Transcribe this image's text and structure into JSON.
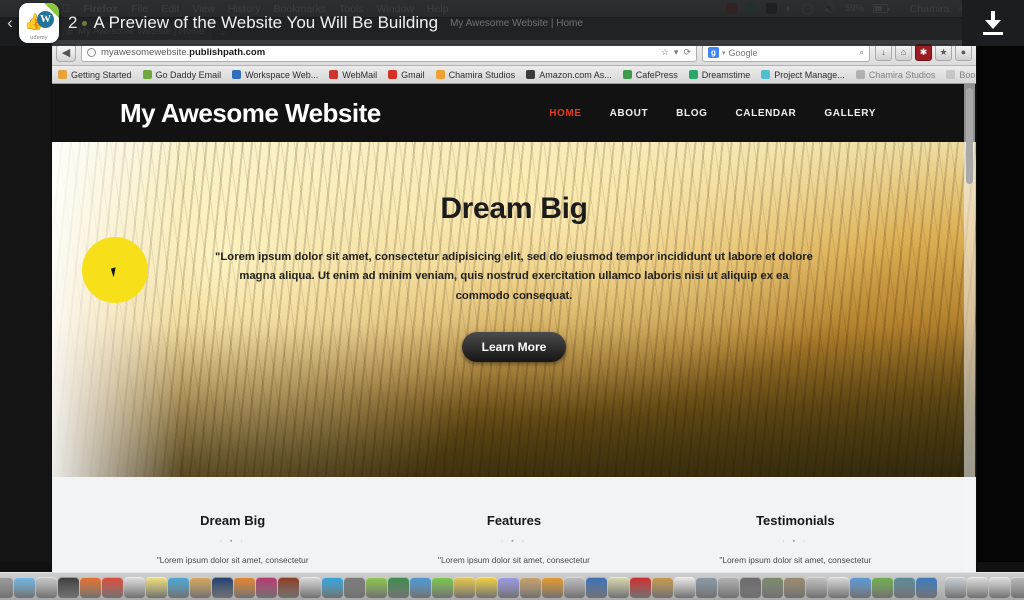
{
  "menubar": {
    "apple": "&#63743;",
    "items": [
      "Firefox",
      "File",
      "Edit",
      "View",
      "History",
      "Bookmarks",
      "Tools",
      "Window",
      "Help"
    ],
    "battery_percent": "59%",
    "user": "Chamira",
    "search_icon": "search-icon",
    "list_icon": "list-icon"
  },
  "overlay": {
    "back_chevron": "‹",
    "lecture_number": "2",
    "lecture_title": "A Preview of the Website You Will Be Building",
    "ghost_title": "My Awesome Website | Home",
    "badge_thumb": "👍",
    "badge_wp": "W",
    "badge_brand": "udemy",
    "download_icon": "download-icon"
  },
  "browser": {
    "tab_title": "My Awesome Website | Home",
    "new_tab": "+",
    "back_arrow": "◀",
    "url_prefix": "myawesomewebsite.",
    "url_domain": "publishpath.com",
    "star_icon": "☆",
    "dropdown_icon": "▾",
    "reload_icon": "⟳",
    "search_engine": "Google",
    "search_g": "g",
    "search_magnifier": "⌕",
    "toolbar_icons": [
      "download-icon",
      "home-icon",
      "adblock-icon",
      "star-icon",
      "firebug-icon"
    ],
    "bookmarks": [
      {
        "label": "Getting Started",
        "color": "#e8a33d"
      },
      {
        "label": "Go Daddy Email",
        "color": "#6fa83c"
      },
      {
        "label": "Workspace Web...",
        "color": "#2f6fbb"
      },
      {
        "label": "WebMail",
        "color": "#d0342c"
      },
      {
        "label": "Gmail",
        "color": "#d93025"
      },
      {
        "label": "Chamira Studios",
        "color": "#f0a030"
      },
      {
        "label": "Amazon.com As...",
        "color": "#3b3b3b"
      },
      {
        "label": "CafePress",
        "color": "#3f9a4d"
      },
      {
        "label": "Dreamstime",
        "color": "#2aa86a"
      },
      {
        "label": "Project Manage...",
        "color": "#4fbfd0"
      },
      {
        "label": "Chamira Studios",
        "color": "#8a8a8a"
      },
      {
        "label": "Bookmarks",
        "color": "#b0b0b0"
      }
    ]
  },
  "site": {
    "logo": "My Awesome Website",
    "nav": [
      {
        "label": "HOME",
        "active": true
      },
      {
        "label": "ABOUT",
        "active": false
      },
      {
        "label": "BLOG",
        "active": false
      },
      {
        "label": "CALENDAR",
        "active": false
      },
      {
        "label": "GALLERY",
        "active": false
      }
    ],
    "hero": {
      "heading": "Dream Big",
      "paragraph": "\"Lorem ipsum dolor sit amet, consectetur adipisicing elit, sed do eiusmod tempor incididunt ut labore et dolore magna aliqua. Ut enim ad minim veniam, quis nostrud exercitation ullamco laboris nisi ut aliquip ex ea commodo consequat.",
      "button": "Learn More"
    },
    "columns": [
      {
        "title": "Dream Big",
        "ornament": "· ▪ ·",
        "text": "\"Lorem ipsum dolor sit amet, consectetur"
      },
      {
        "title": "Features",
        "ornament": "· ▪ ·",
        "text": "\"Lorem ipsum dolor sit amet, consectetur"
      },
      {
        "title": "Testimonials",
        "ornament": "· ▪ ·",
        "text": "\"Lorem ipsum dolor sit amet, consectetur"
      }
    ]
  },
  "dock": {
    "icons": [
      "#4a7fc1",
      "#9a9a9a",
      "#6fb7e8",
      "#c8c8c8",
      "#3a3a3a",
      "#e8702a",
      "#e04a3a",
      "#dedede",
      "#f0e27a",
      "#4aa8d8",
      "#d8a85a",
      "#1f3d6e",
      "#e8832a",
      "#b8356f",
      "#8a3a1f",
      "#d8d8d8",
      "#2fa8e0",
      "#7a7a7a",
      "#8ac84a",
      "#3a8a4a",
      "#4a9ad8",
      "#7ac84a",
      "#e8c84a",
      "#f0d040",
      "#9a9ae8",
      "#caa26a",
      "#e89a2a",
      "#bdbdbd",
      "#3a6fb8",
      "#d8d8b0",
      "#d02a2a",
      "#c89a4a",
      "#e8e8e8",
      "#8a9aa8",
      "#b0b0b0",
      "#6a6a6a",
      "#7a8a6a",
      "#9a8a6a",
      "#c0c0c0",
      "#d8d8d8",
      "#5a9ad8",
      "#6fae4a",
      "#5a8a9a",
      "#3a7ac0",
      "#c8d0d8",
      "#dcdcdc",
      "#e0e0e0",
      "#b8b8b8",
      "#9fa5a8"
    ]
  }
}
